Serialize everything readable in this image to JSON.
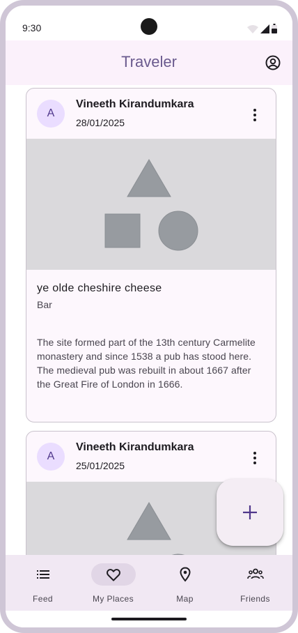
{
  "status_bar": {
    "time": "9:30"
  },
  "app_bar": {
    "title": "Traveler"
  },
  "posts": [
    {
      "avatar_letter": "A",
      "author": "Vineeth Kirandumkara",
      "date": "28/01/2025",
      "title": "ye olde cheshire cheese",
      "type": "Bar",
      "description": "The site formed part of the 13th century Carmelite monastery and since 1538 a pub has stood here. The medieval pub was rebuilt in about 1667 after the Great Fire of London in 1666."
    },
    {
      "avatar_letter": "A",
      "author": "Vineeth Kirandumkara",
      "date": "25/01/2025"
    }
  ],
  "fab": {
    "icon": "plus-icon"
  },
  "bottom_nav": [
    {
      "label": "Feed",
      "icon": "list-icon",
      "active": false
    },
    {
      "label": "My Places",
      "icon": "heart-icon",
      "active": true
    },
    {
      "label": "Map",
      "icon": "location-pin-icon",
      "active": false
    },
    {
      "label": "Friends",
      "icon": "group-icon",
      "active": false
    }
  ],
  "colors": {
    "primary": "#6a5a8e",
    "surface": "#fdf7fd",
    "avatar_bg": "#eaddff",
    "nav_indicator": "#e1d6e6",
    "placeholder": "#dad9dc"
  }
}
